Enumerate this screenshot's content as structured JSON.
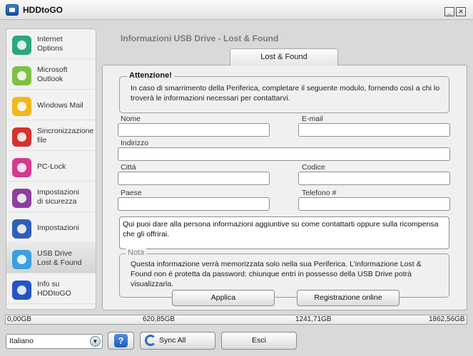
{
  "window": {
    "title": "HDDtoGO",
    "minimize_icon": "minimize-icon",
    "close_icon": "close-icon"
  },
  "sidebar": {
    "items": [
      {
        "label": "Internet\nOptions",
        "icon": "internet-options-icon",
        "color": "#2aa87a"
      },
      {
        "label": "Microsoft\nOutlook",
        "icon": "outlook-icon",
        "color": "#7cc242"
      },
      {
        "label": "Windows Mail",
        "icon": "mail-icon",
        "color": "#f0b81e"
      },
      {
        "label": "Sincronizzazione\nfile",
        "icon": "sync-files-icon",
        "color": "#d4312f"
      },
      {
        "label": "PC-Lock",
        "icon": "pc-lock-icon",
        "color": "#d63a8e"
      },
      {
        "label": "Impostazioni\ndi sicurezza",
        "icon": "security-lock-icon",
        "color": "#8c3f9e"
      },
      {
        "label": "Impostazioni",
        "icon": "settings-gears-icon",
        "color": "#2f5fb8"
      },
      {
        "label": "USB Drive\nLost & Found",
        "icon": "lost-found-icon",
        "color": "#3d9fe0",
        "active": true
      },
      {
        "label": "Info su\nHDDtoGO",
        "icon": "info-icon",
        "color": "#2453c4"
      }
    ]
  },
  "panel": {
    "title": "Informazioni USB Drive - Lost & Found",
    "tab": "Lost & Found",
    "attention": {
      "legend": "Attenzione!",
      "text": "In caso di smarrimento della Periferica, completare il seguente modulo, fornendo così a chi lo troverà le informazioni necessari per contattarvi."
    },
    "fields": {
      "nome": {
        "label": "Nome",
        "value": ""
      },
      "email": {
        "label": "E-mail",
        "value": ""
      },
      "indirizzo": {
        "label": "Indirizzo",
        "value": ""
      },
      "citta": {
        "label": "Cittá",
        "value": ""
      },
      "codice": {
        "label": "Codice",
        "value": ""
      },
      "paese": {
        "label": "Paese",
        "value": ""
      },
      "telefono": {
        "label": "Telefono #",
        "value": ""
      }
    },
    "extra_info": "Qui puoi dare alla persona informazioni aggiuntive su come contattarti oppure sulla ricompensa che gli offrirai.",
    "nota": {
      "legend": "Nota",
      "text": "Questa informazione verrà memorizzata solo nella sua Periferica. L'informazione Lost & Found non é protetta da password: chiunque entri in possesso della USB Drive potrà visualizzarla."
    },
    "apply_button": "Applica",
    "register_button": "Registrazione online"
  },
  "storage": {
    "labels": [
      "0,00GB",
      "620,85GB",
      "1241,71GB",
      "1862,56GB"
    ]
  },
  "footer": {
    "language": "Italiano",
    "help_label": "?",
    "sync_all": "Sync All",
    "exit": "Esci"
  }
}
